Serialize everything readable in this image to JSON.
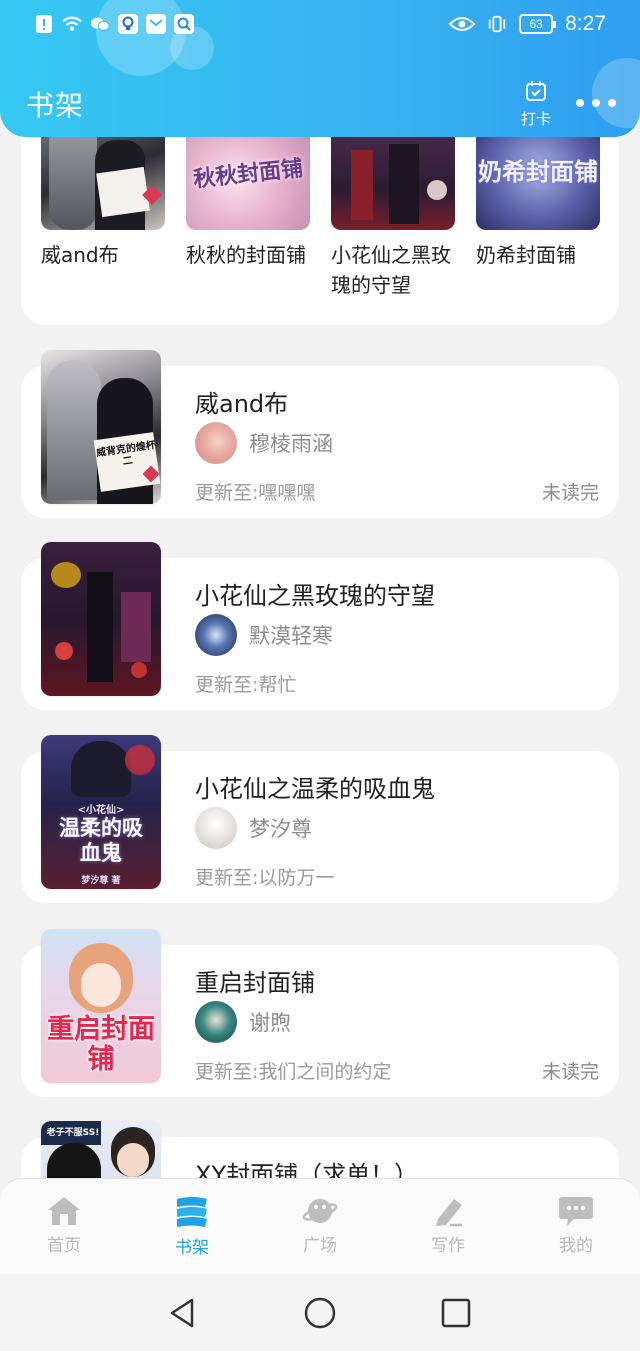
{
  "status_bar": {
    "time": "8:27",
    "battery": "63"
  },
  "header": {
    "title": "书架",
    "checkin_label": "打卡"
  },
  "top_grid": [
    {
      "title": "威and布"
    },
    {
      "title": "秋秋的封面铺",
      "cover_text": "秋秋封面铺"
    },
    {
      "title": "小花仙之黑玫瑰的守望"
    },
    {
      "title": "奶希封面铺",
      "cover_text": "奶希封面铺"
    }
  ],
  "books": [
    {
      "title": "威and布",
      "author": "穆棱雨涵",
      "update_prefix": "更新至:",
      "update": "嘿嘿嘿",
      "status": "未读完",
      "cover_text": "威背克的煌杯二"
    },
    {
      "title": "小花仙之黑玫瑰的守望",
      "author": "默漠轻寒",
      "update_prefix": "更新至:",
      "update": "帮忙",
      "status": ""
    },
    {
      "title": "小花仙之温柔的吸血鬼",
      "author": "梦汐尊",
      "update_prefix": "更新至:",
      "update": "以防万一",
      "status": "",
      "cover_text_small": "<小花仙>",
      "cover_text_big": "温柔的吸血鬼",
      "cover_text_author": "梦汐尊 著"
    },
    {
      "title": "重启封面铺",
      "author": "谢煦",
      "update_prefix": "更新至:",
      "update": "我们之间的约定",
      "status": "未读完",
      "cover_text_big": "重启封面铺"
    },
    {
      "title": "XY封面铺（求单！）",
      "author": "",
      "update_prefix": "",
      "update": "",
      "status": "",
      "cover_text_small": "老子不服SS!"
    }
  ],
  "tabs": [
    {
      "label": "首页",
      "icon": "home-icon",
      "active": false
    },
    {
      "label": "书架",
      "icon": "bookshelf-icon",
      "active": true
    },
    {
      "label": "广场",
      "icon": "planet-icon",
      "active": false
    },
    {
      "label": "写作",
      "icon": "pen-icon",
      "active": false
    },
    {
      "label": "我的",
      "icon": "chat-bubble-icon",
      "active": false
    }
  ],
  "colors": {
    "accent": "#1da3e8",
    "header_start": "#35c8f3",
    "header_end": "#2f9ef0",
    "tab_inactive": "#b8b8b8"
  }
}
